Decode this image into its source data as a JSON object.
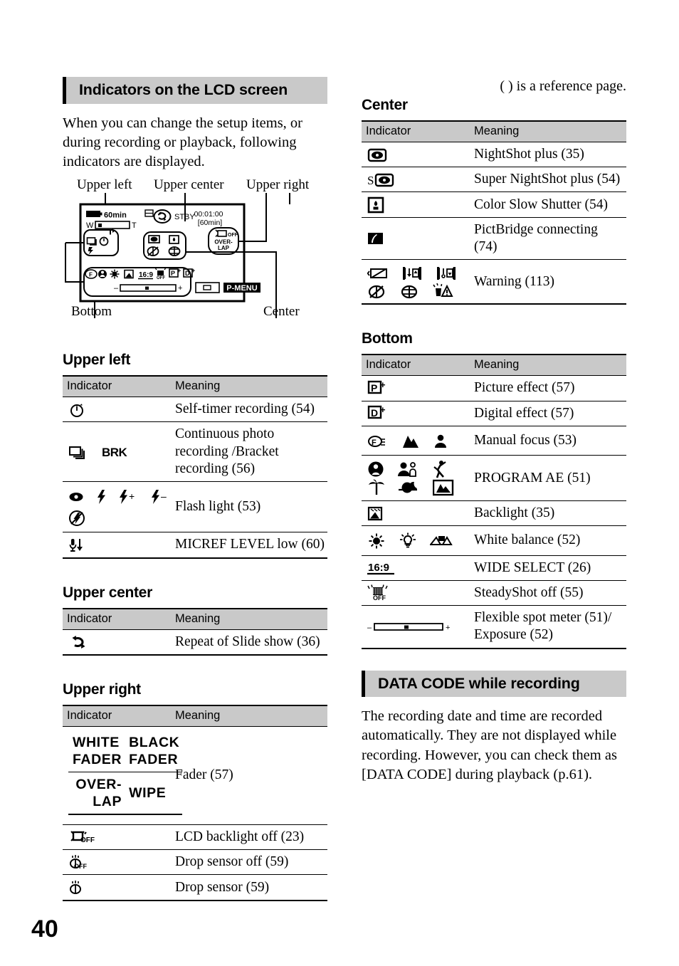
{
  "page_number": "40",
  "reference_note": "( ) is a reference page.",
  "left_column": {
    "section_title": "Indicators on the LCD screen",
    "intro_text": "When you can change the setup items, or during recording or playback, following indicators are displayed.",
    "diagram": {
      "label_upper_left": "Upper left",
      "label_upper_center": "Upper center",
      "label_upper_right": "Upper right",
      "label_bottom": "Bottom",
      "label_center": "Center",
      "screen": {
        "battery_time": "60min",
        "zoom_w": "W",
        "zoom_t": "T",
        "status": "STBY",
        "timecode": "00:01:00",
        "remaining": "[60min]",
        "fader_label": "OVER-LAP",
        "lcd_off_label": "OFF",
        "wide_label": "16:9",
        "picture_effect": "P",
        "digital_effect": "D",
        "pmenu": "P-MENU"
      }
    },
    "sections": [
      {
        "title": "Upper left",
        "header": {
          "indicator": "Indicator",
          "meaning": "Meaning"
        },
        "rows": [
          {
            "icons": [
              "self-timer-icon"
            ],
            "meaning": "Self-timer recording (54)"
          },
          {
            "icons": [
              "continuous-photo-icon",
              "brk-text-icon"
            ],
            "meaning": "Continuous photo recording /Bracket recording (56)"
          },
          {
            "icons": [
              "red-eye-icon",
              "flash-icon",
              "flash-plus-icon",
              "flash-minus-icon",
              "flash-off-icon"
            ],
            "meaning": "Flash light (53)"
          },
          {
            "icons": [
              "micref-level-low-icon"
            ],
            "meaning": "MICREF LEVEL low (60)"
          }
        ]
      },
      {
        "title": "Upper center",
        "header": {
          "indicator": "Indicator",
          "meaning": "Meaning"
        },
        "rows": [
          {
            "icons": [
              "repeat-slideshow-icon"
            ],
            "meaning": "Repeat of Slide show (36)"
          }
        ]
      },
      {
        "title": "Upper right",
        "header": {
          "indicator": "Indicator",
          "meaning": "Meaning"
        },
        "rows": [
          {
            "icons": [
              "fader-labels-icon"
            ],
            "labels": [
              "WHITE FADER",
              "BLACK FADER",
              "OVER- LAP",
              "WIPE"
            ],
            "meaning": "Fader (57)"
          },
          {
            "icons": [
              "lcd-backlight-off-icon"
            ],
            "meaning": "LCD backlight off (23)"
          },
          {
            "icons": [
              "drop-sensor-off-icon"
            ],
            "meaning": "Drop sensor off (59)"
          },
          {
            "icons": [
              "drop-sensor-icon"
            ],
            "meaning": "Drop sensor (59)"
          }
        ]
      }
    ]
  },
  "right_column": {
    "sections": [
      {
        "title": "Center",
        "header": {
          "indicator": "Indicator",
          "meaning": "Meaning"
        },
        "rows": [
          {
            "icons": [
              "nightshot-icon"
            ],
            "meaning": "NightShot plus (35)"
          },
          {
            "icons": [
              "super-nightshot-icon"
            ],
            "meaning": "Super NightShot plus (54)"
          },
          {
            "icons": [
              "color-slow-shutter-icon"
            ],
            "meaning": "Color Slow Shutter (54)"
          },
          {
            "icons": [
              "pictbridge-icon"
            ],
            "meaning": "PictBridge connecting (74)"
          },
          {
            "icons": [
              "battery-warning-icon",
              "tape-in-icon",
              "tape-out-icon",
              "disc-warning-icon",
              "disc-error-icon",
              "drop-warning-icon"
            ],
            "meaning": "Warning (113)"
          }
        ]
      },
      {
        "title": "Bottom",
        "header": {
          "indicator": "Indicator",
          "meaning": "Meaning"
        },
        "rows": [
          {
            "icons": [
              "picture-effect-icon"
            ],
            "meaning": "Picture effect (57)"
          },
          {
            "icons": [
              "digital-effect-icon"
            ],
            "meaning": "Digital effect (57)"
          },
          {
            "icons": [
              "manual-focus-icon",
              "mountain-focus-icon",
              "person-focus-icon"
            ],
            "meaning": "Manual focus (53)"
          },
          {
            "icons": [
              "spotlight-icon",
              "portrait-icon",
              "sports-icon",
              "beach-icon",
              "sunset-icon",
              "landscape-icon"
            ],
            "meaning": "PROGRAM AE (51)"
          },
          {
            "icons": [
              "backlight-icon"
            ],
            "meaning": "Backlight (35)"
          },
          {
            "icons": [
              "outdoor-wb-icon",
              "indoor-wb-icon",
              "one-push-wb-icon"
            ],
            "meaning": "White balance (52)"
          },
          {
            "icons": [
              "wide-select-icon"
            ],
            "meaning": "WIDE SELECT (26)"
          },
          {
            "icons": [
              "steadyshot-off-icon"
            ],
            "meaning": "SteadyShot off (55)"
          },
          {
            "icons": [
              "exposure-slider-icon"
            ],
            "meaning": "Flexible spot meter (51)/ Exposure (52)"
          }
        ]
      }
    ],
    "data_code": {
      "section_title": "DATA CODE while recording",
      "body_text": "The recording date and time are recorded automatically. They are not displayed while recording. However, you can check them as [DATA CODE] during playback (p.61)."
    }
  }
}
